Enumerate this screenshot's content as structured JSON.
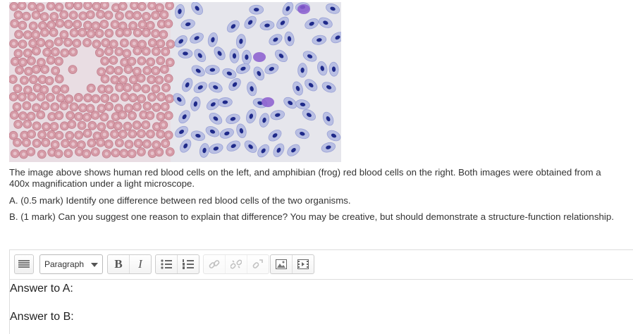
{
  "question": {
    "intro": "The image above shows human red blood cells on the left, and amphibian (frog) red blood cells on the right. Both images were obtained from a 400x magnification under a light microscope.",
    "part_a": "A. (0.5 mark) Identify one difference between red blood cells of the two organisms.",
    "part_b": "B. (1 mark) Can you suggest one reason to explain that difference? You may be creative, but should demonstrate a structure-function relationship."
  },
  "editor": {
    "format_select": "Paragraph",
    "toolbar_icons": [
      "toolbar-toggle-icon",
      "bold-icon",
      "italic-icon",
      "bullet-list-icon",
      "numbered-list-icon",
      "link-icon",
      "unlink-icon",
      "anchor-icon",
      "image-icon",
      "media-icon"
    ],
    "answer_lines": [
      "Answer to A:",
      "Answer to B:"
    ]
  }
}
